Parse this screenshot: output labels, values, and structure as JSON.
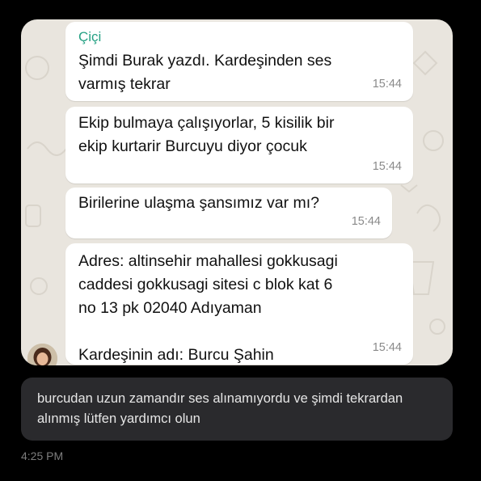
{
  "messages": [
    {
      "sender": "Çiçi",
      "text": "Şimdi Burak yazdı. Kardeşinden ses\nvarmış tekrar",
      "time": "15:44"
    },
    {
      "text": "Ekip bulmaya çalışıyorlar, 5 kisilik bir\nekip kurtarir Burcuyu diyor çocuk",
      "time": "15:44"
    },
    {
      "text": "Birilerine ulaşma şansımız var mı?",
      "time": "15:44"
    },
    {
      "text": "Adres: altinsehir mahallesi gokkusagi\ncaddesi gokkusagi sitesi c blok kat 6\nno 13 pk 02040 Adıyaman\n\nKardeşinin adı: Burcu Şahin",
      "time": "15:44"
    }
  ],
  "post": {
    "text": "burcudan uzun zamandır ses alınamıyordu ve şimdi tekrardan alınmış lütfen yardımcı olun",
    "timestamp": "4:25 PM"
  },
  "colors": {
    "sender_name": "#25a184",
    "chat_background": "#e9e5de",
    "bubble": "#ffffff",
    "reply_box": "#2a2a2d",
    "page_background": "#000000"
  }
}
